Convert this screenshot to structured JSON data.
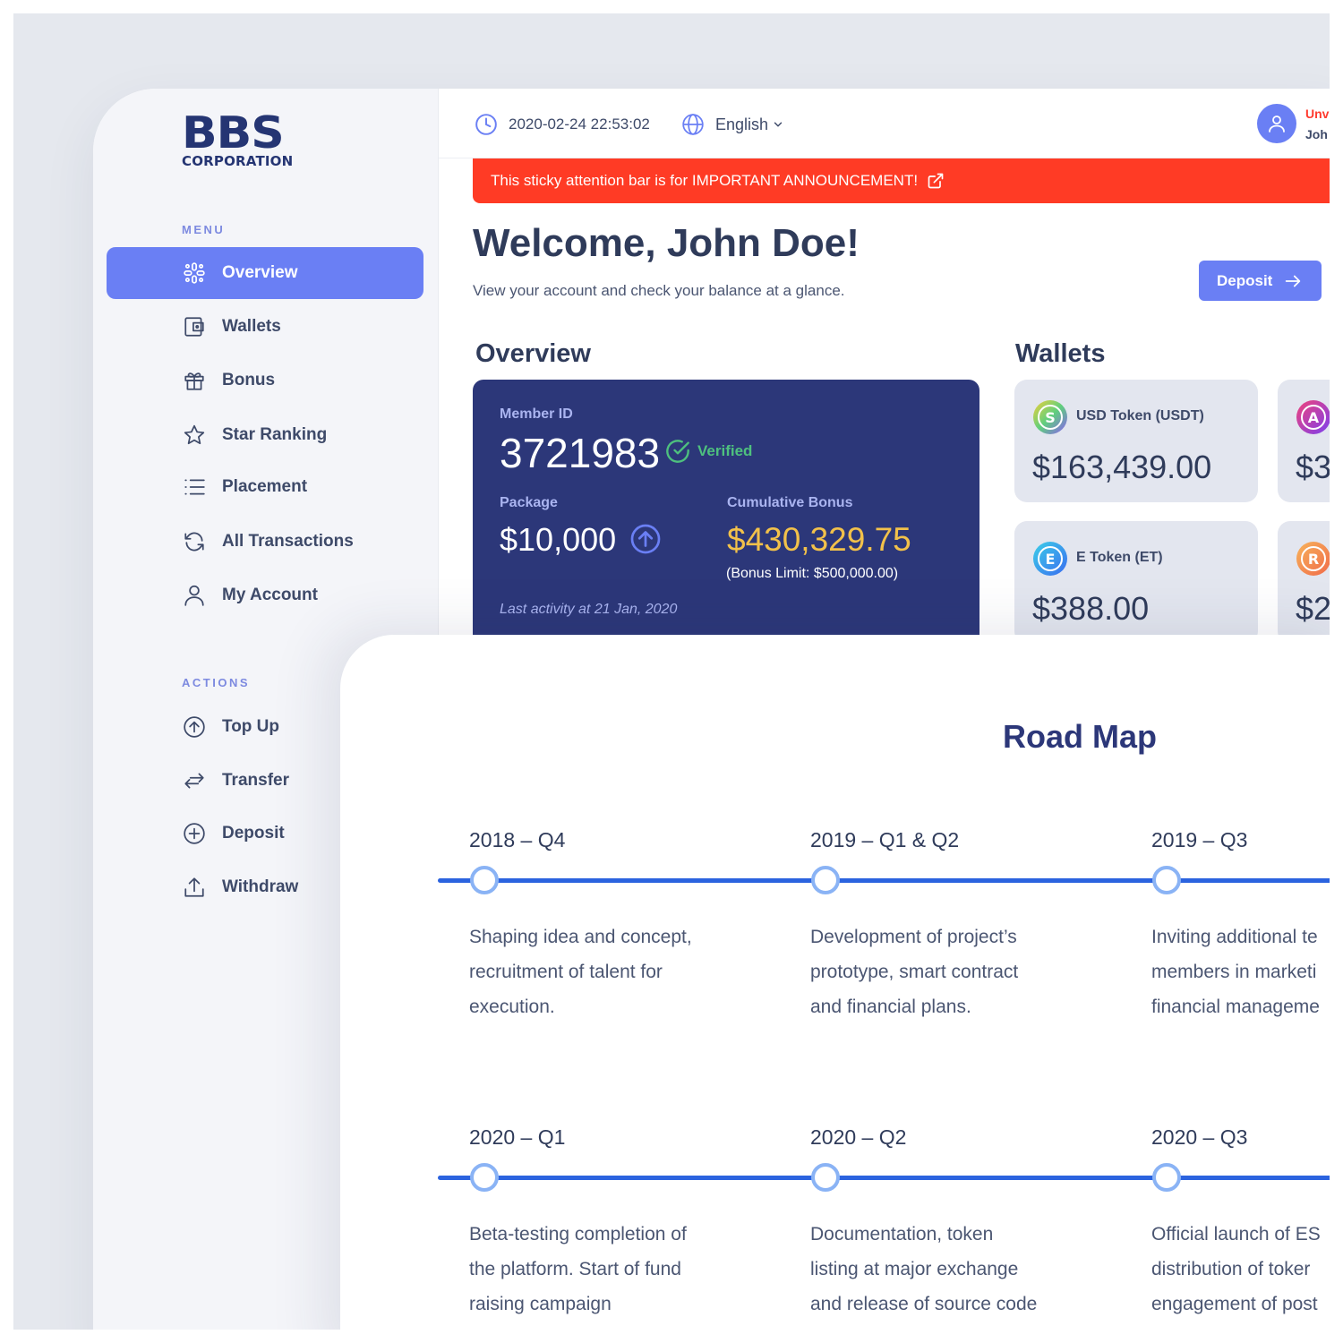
{
  "logo": {
    "line1": "BBS",
    "line2": "CORPORATION"
  },
  "sidebar": {
    "menu_label": "MENU",
    "menu": [
      {
        "label": "Overview",
        "icon": "overview-icon",
        "active": true
      },
      {
        "label": "Wallets",
        "icon": "wallet-icon"
      },
      {
        "label": "Bonus",
        "icon": "gift-icon"
      },
      {
        "label": "Star Ranking",
        "icon": "star-icon"
      },
      {
        "label": "Placement",
        "icon": "list-icon"
      },
      {
        "label": "All Transactions",
        "icon": "refresh-icon"
      },
      {
        "label": "My Account",
        "icon": "user-icon"
      }
    ],
    "actions_label": "ACTIONS",
    "actions": [
      {
        "label": "Top Up",
        "icon": "arrow-up-circle-icon"
      },
      {
        "label": "Transfer",
        "icon": "transfer-icon"
      },
      {
        "label": "Deposit",
        "icon": "plus-circle-icon"
      },
      {
        "label": "Withdraw",
        "icon": "upload-icon"
      }
    ]
  },
  "topbar": {
    "datetime": "2020-02-24 22:53:02",
    "language": "English",
    "user_status": "Unv",
    "user_name": "Joh"
  },
  "announcement": {
    "text": "This sticky attention bar is for IMPORTANT ANNOUNCEMENT!"
  },
  "header": {
    "welcome": "Welcome, John Doe!",
    "subtitle": "View your account and check your balance at a glance.",
    "deposit_label": "Deposit"
  },
  "overview": {
    "heading": "Overview",
    "member_id_label": "Member ID",
    "member_id": "3721983",
    "verified": "Verified",
    "package_label": "Package",
    "package_value": "$10,000",
    "bonus_label": "Cumulative Bonus",
    "bonus_value": "$430,329.75",
    "bonus_limit": "(Bonus Limit: $500,000.00)",
    "last_activity": "Last activity at 21 Jan, 2020"
  },
  "wallets": {
    "heading": "Wallets",
    "items": [
      {
        "name": "USD Token (USDT)",
        "value": "$163,439.00",
        "coin_letter": "S"
      },
      {
        "name": "",
        "value": "$3",
        "coin_letter": "A"
      },
      {
        "name": "E Token (ET)",
        "value": "$388.00",
        "coin_letter": "E"
      },
      {
        "name": "",
        "value": "$2",
        "coin_letter": "R"
      }
    ]
  },
  "roadmap": {
    "title": "Road Map",
    "rows": [
      [
        {
          "quarter": "2018 – Q4",
          "lines": [
            "Shaping idea and concept,",
            "recruitment of talent for",
            "execution."
          ]
        },
        {
          "quarter": "2019 – Q1 & Q2",
          "lines": [
            "Development of project’s",
            "prototype, smart contract",
            "and financial plans."
          ]
        },
        {
          "quarter": "2019 – Q3",
          "lines": [
            "Inviting additional te",
            "members in marketi",
            "financial manageme"
          ]
        }
      ],
      [
        {
          "quarter": "2020 – Q1",
          "lines": [
            "Beta-testing completion of",
            "the platform. Start of fund",
            "raising campaign"
          ]
        },
        {
          "quarter": "2020 – Q2",
          "lines": [
            "Documentation, token",
            "listing at major exchange",
            "and release of source code"
          ]
        },
        {
          "quarter": "2020 – Q3",
          "lines": [
            "Official launch of ES",
            "distribution of toker",
            "engagement of post"
          ]
        }
      ]
    ]
  },
  "colors": {
    "accent": "#6a7ff4",
    "navy": "#2c3779",
    "alert": "#ff3b25",
    "gold": "#f2c14a",
    "verified": "#4ec07e",
    "timeline": "#2b63df"
  }
}
